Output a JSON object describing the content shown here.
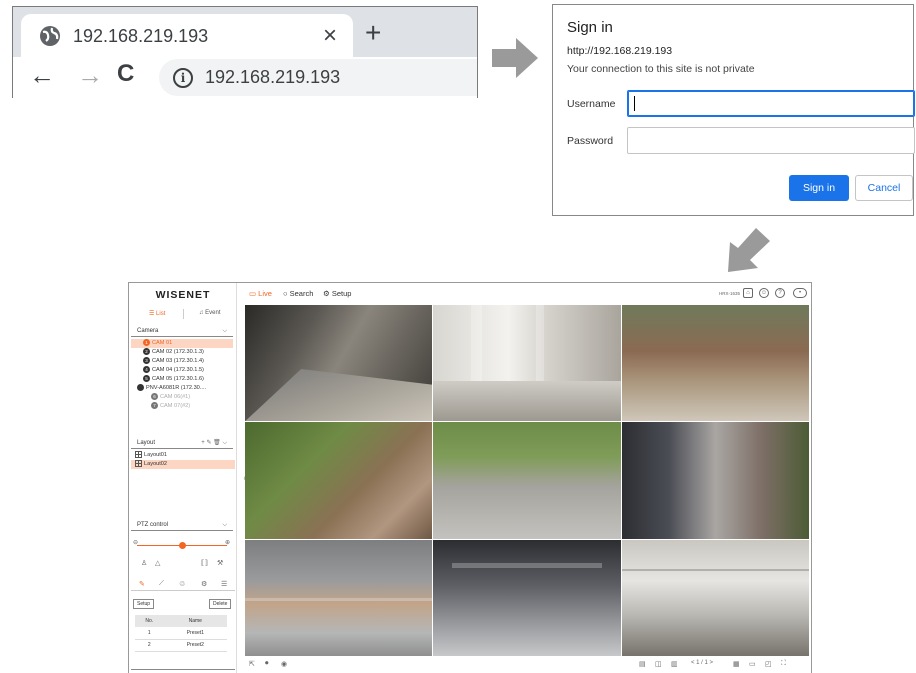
{
  "browser": {
    "tab_title": "192.168.219.193",
    "address": "192.168.219.193",
    "new_tab": "+",
    "close": "×"
  },
  "signin": {
    "title": "Sign in",
    "url": "http://192.168.219.193",
    "warning": "Your connection to this site is not private",
    "username_label": "Username",
    "password_label": "Password",
    "username_value": "",
    "password_value": "",
    "signin_button": "Sign in",
    "cancel_button": "Cancel"
  },
  "app": {
    "logo": "WISENET",
    "tabs": {
      "list": "☰ List",
      "event": "♫ Event"
    },
    "camera_header": "Camera",
    "cameras": [
      {
        "num": "1",
        "label": "CAM 01",
        "selected": true
      },
      {
        "num": "2",
        "label": "CAM 02 (172.30.1.3)"
      },
      {
        "num": "3",
        "label": "CAM 03 (172.30.1.4)"
      },
      {
        "num": "4",
        "label": "CAM 04 (172.30.1.5)"
      },
      {
        "num": "5",
        "label": "CAM 05 (172.30.1.6)"
      },
      {
        "num": "",
        "label": "PNV-A6081R (172.30...."
      },
      {
        "num": "6",
        "label": "CAM 06(#1)"
      },
      {
        "num": "7",
        "label": "CAM 07(#2)"
      }
    ],
    "layout_header": "Layout",
    "layouts": [
      {
        "label": "Layout01"
      },
      {
        "label": "Layout02",
        "selected": true
      }
    ],
    "ptz_header": "PTZ control",
    "setup_btn": "Setup",
    "delete_btn": "Delete",
    "preset_cols": [
      "No.",
      "Name"
    ],
    "presets": [
      {
        "no": "1",
        "name": "Preset1"
      },
      {
        "no": "2",
        "name": "Preset2"
      }
    ],
    "top": {
      "live": "Live",
      "search": "Search",
      "setup": "Setup",
      "model": "HRX-1635"
    },
    "pager": "< 1 / 1 >"
  },
  "colors": {
    "accent": "#f26522",
    "signin_blue": "#1a73e8"
  }
}
